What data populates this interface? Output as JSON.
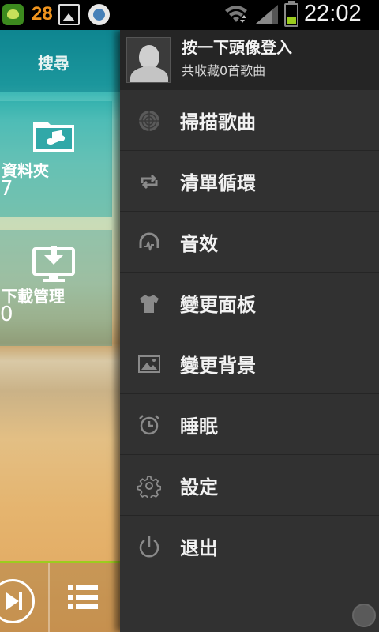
{
  "status_bar": {
    "number": "28",
    "time": "22:02",
    "battery_level": 0.4,
    "icons": [
      "app-icon",
      "image-icon",
      "cast-icon",
      "wifi-icon",
      "signal-icon",
      "battery-icon"
    ]
  },
  "app": {
    "search_label": "搜尋",
    "tiles": [
      {
        "label": "資料夾",
        "count": "7",
        "icon": "folder-music-icon"
      },
      {
        "label": "下載管理",
        "count": "0",
        "icon": "download-monitor-icon"
      }
    ],
    "player": {
      "icons": [
        "play-next-icon",
        "playlist-icon"
      ]
    }
  },
  "drawer": {
    "header": {
      "login_text": "按一下頭像登入",
      "favorites_text": "共收藏0首歌曲",
      "avatar_icon": "avatar-icon"
    },
    "menu": [
      {
        "label": "掃描歌曲",
        "icon": "radar-icon"
      },
      {
        "label": "清單循環",
        "icon": "repeat-icon"
      },
      {
        "label": "音效",
        "icon": "headphones-icon"
      },
      {
        "label": "變更面板",
        "icon": "tshirt-icon"
      },
      {
        "label": "變更背景",
        "icon": "image-icon"
      },
      {
        "label": "睡眠",
        "icon": "alarm-clock-icon"
      },
      {
        "label": "設定",
        "icon": "gear-icon"
      },
      {
        "label": "退出",
        "icon": "power-icon"
      }
    ]
  },
  "colors": {
    "drawer_bg": "#313131",
    "header_bg": "#252525",
    "accent": "#9ccd1e",
    "status_number": "#f0941e"
  }
}
